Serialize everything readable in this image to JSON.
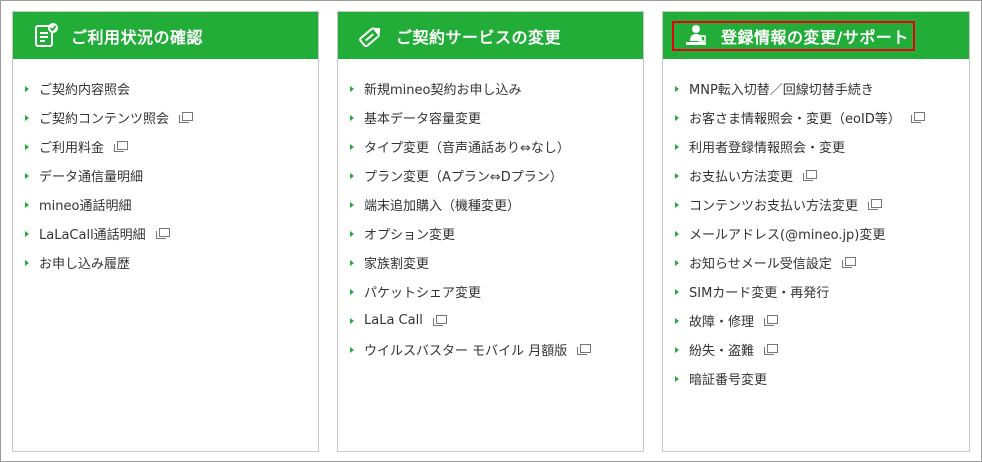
{
  "panels": [
    {
      "title": "ご利用状況の確認",
      "icon": "notepad-check-icon",
      "items": [
        {
          "label": "ご契約内容照会",
          "external": false
        },
        {
          "label": "ご契約コンテンツ照会",
          "external": true
        },
        {
          "label": "ご利用料金",
          "external": true
        },
        {
          "label": "データ通信量明細",
          "external": false
        },
        {
          "label": "mineo通話明細",
          "external": false
        },
        {
          "label": "LaLaCall通話明細",
          "external": true
        },
        {
          "label": "お申し込み履歴",
          "external": false
        }
      ]
    },
    {
      "title": "ご契約サービスの変更",
      "icon": "pencil-tag-icon",
      "items": [
        {
          "label": "新規mineo契約お申し込み",
          "external": false
        },
        {
          "label": "基本データ容量変更",
          "external": false
        },
        {
          "label": "タイプ変更（音声通話あり⇔なし）",
          "external": false
        },
        {
          "label": "プラン変更（Aプラン⇔Dプラン）",
          "external": false
        },
        {
          "label": "端末追加購入（機種変更）",
          "external": false
        },
        {
          "label": "オプション変更",
          "external": false
        },
        {
          "label": "家族割変更",
          "external": false
        },
        {
          "label": "パケットシェア変更",
          "external": false
        },
        {
          "label": "LaLa Call",
          "external": true
        },
        {
          "label": "ウイルスバスター モバイル 月額版",
          "external": true
        }
      ]
    },
    {
      "title": "登録情報の変更/サポート",
      "icon": "person-desk-icon",
      "items": [
        {
          "label": "MNP転入切替／回線切替手続き",
          "external": false,
          "highlighted": true
        },
        {
          "label": "お客さま情報照会・変更（eoID等）",
          "external": true
        },
        {
          "label": "利用者登録情報照会・変更",
          "external": false
        },
        {
          "label": "お支払い方法変更",
          "external": true
        },
        {
          "label": "コンテンツお支払い方法変更",
          "external": true
        },
        {
          "label": "メールアドレス(@mineo.jp)変更",
          "external": false
        },
        {
          "label": "お知らせメール受信設定",
          "external": true
        },
        {
          "label": "SIMカード変更・再発行",
          "external": false
        },
        {
          "label": "故障・修理",
          "external": true
        },
        {
          "label": "紛失・盗難",
          "external": true
        },
        {
          "label": "暗証番号変更",
          "external": false
        }
      ]
    }
  ],
  "colors": {
    "header_green": "#22ac38",
    "highlight_red": "#e60012",
    "text": "#333333"
  }
}
